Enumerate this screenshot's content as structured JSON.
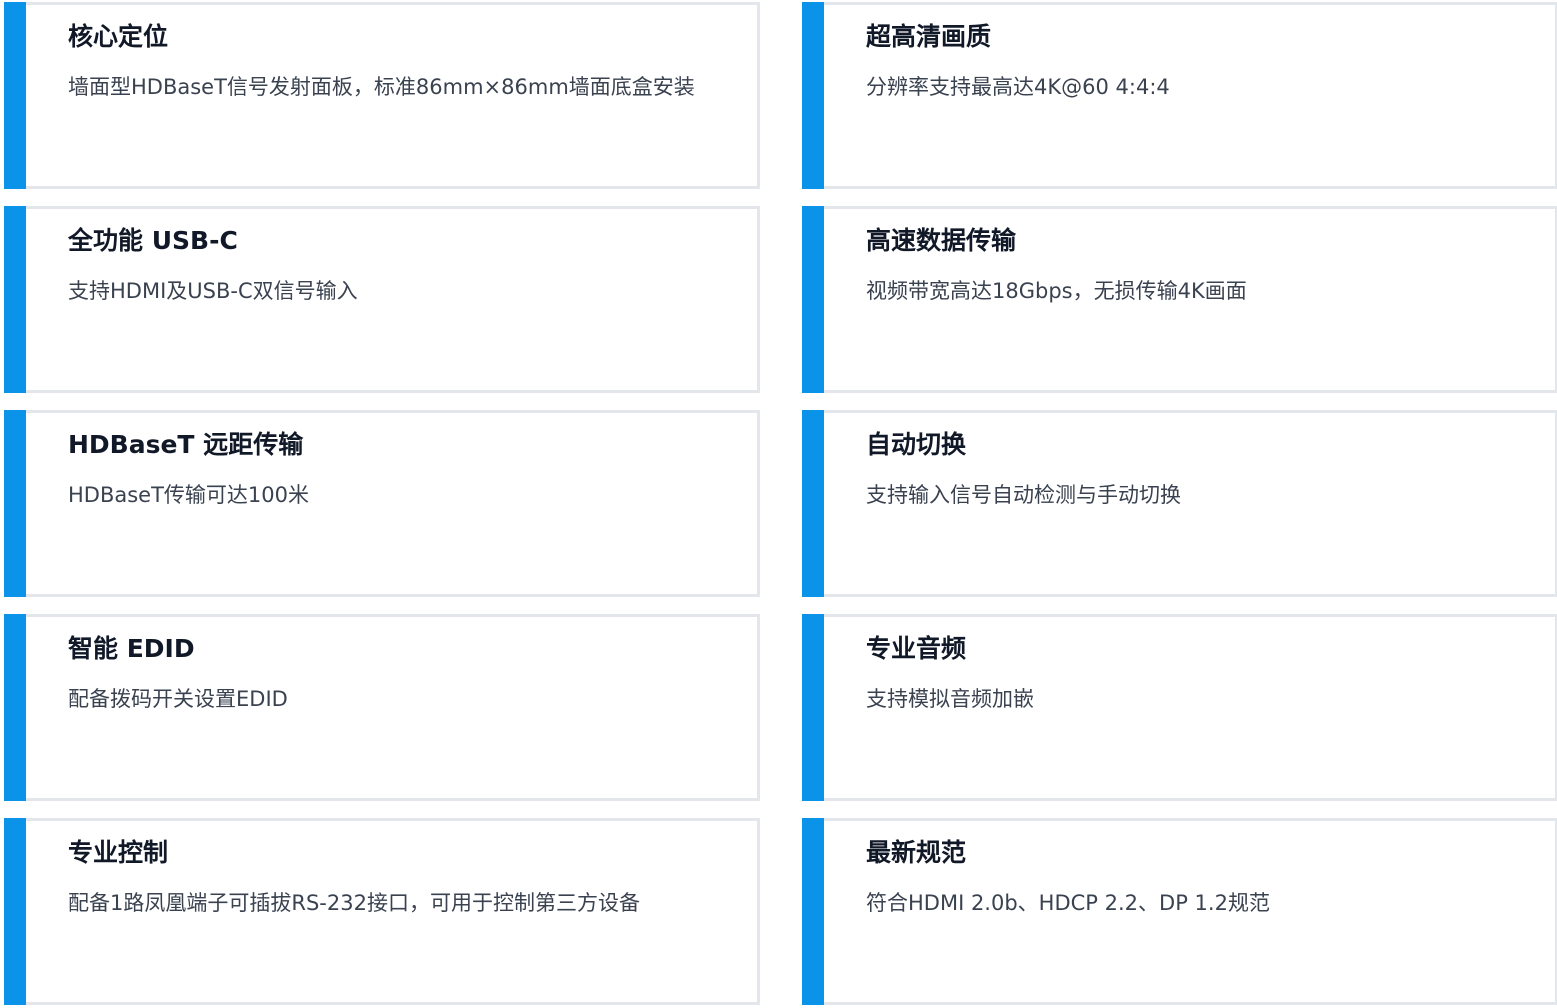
{
  "features": [
    {
      "title": "核心定位",
      "desc": "墙面型HDBaseT信号发射面板，标准86mm×86mm墙面底盒安装"
    },
    {
      "title": "超高清画质",
      "desc": "分辨率支持最高达4K@60 4:4:4"
    },
    {
      "title": "全功能 USB-C",
      "desc": "支持HDMI及USB-C双信号输入"
    },
    {
      "title": "高速数据传输",
      "desc": "视频带宽高达18Gbps，无损传输4K画面"
    },
    {
      "title": "HDBaseT 远距传输",
      "desc": "HDBaseT传输可达100米"
    },
    {
      "title": "自动切换",
      "desc": "支持输入信号自动检测与手动切换"
    },
    {
      "title": "智能 EDID",
      "desc": "配备拨码开关设置EDID"
    },
    {
      "title": "专业音频",
      "desc": "支持模拟音频加嵌"
    },
    {
      "title": "专业控制",
      "desc": "配备1路凤凰端子可插拔RS-232接口，可用于控制第三方设备"
    },
    {
      "title": "最新规范",
      "desc": "符合HDMI 2.0b、HDCP 2.2、DP 1.2规范"
    }
  ],
  "colors": {
    "accent": "#0b93ea",
    "border": "#e3e7ec",
    "title": "#111827",
    "text": "#3a4250"
  }
}
